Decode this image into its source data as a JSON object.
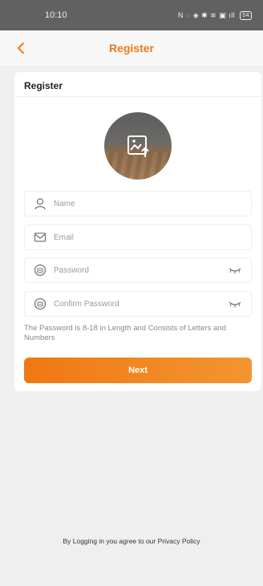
{
  "status_bar": {
    "time": "10:10",
    "icons": "N ◌ ◈ ✱ ≋ ▣ ıll",
    "battery": "54"
  },
  "nav": {
    "title": "Register"
  },
  "card": {
    "title": "Register",
    "avatar_icon": "image-upload-icon",
    "fields": {
      "name_placeholder": "Name",
      "email_placeholder": "Email",
      "password_placeholder": "Password",
      "confirm_password_placeholder": "Confirm Password"
    },
    "hint": "The Password is 8-18 in Length and Consists of Letters and Numbers",
    "next_label": "Next"
  },
  "footer": {
    "policy_text": "By Logging in you agree to our Privacy Policy"
  },
  "colors": {
    "accent": "#ee7a1a",
    "button_gradient_start": "#f07813",
    "button_gradient_end": "#f39530"
  }
}
